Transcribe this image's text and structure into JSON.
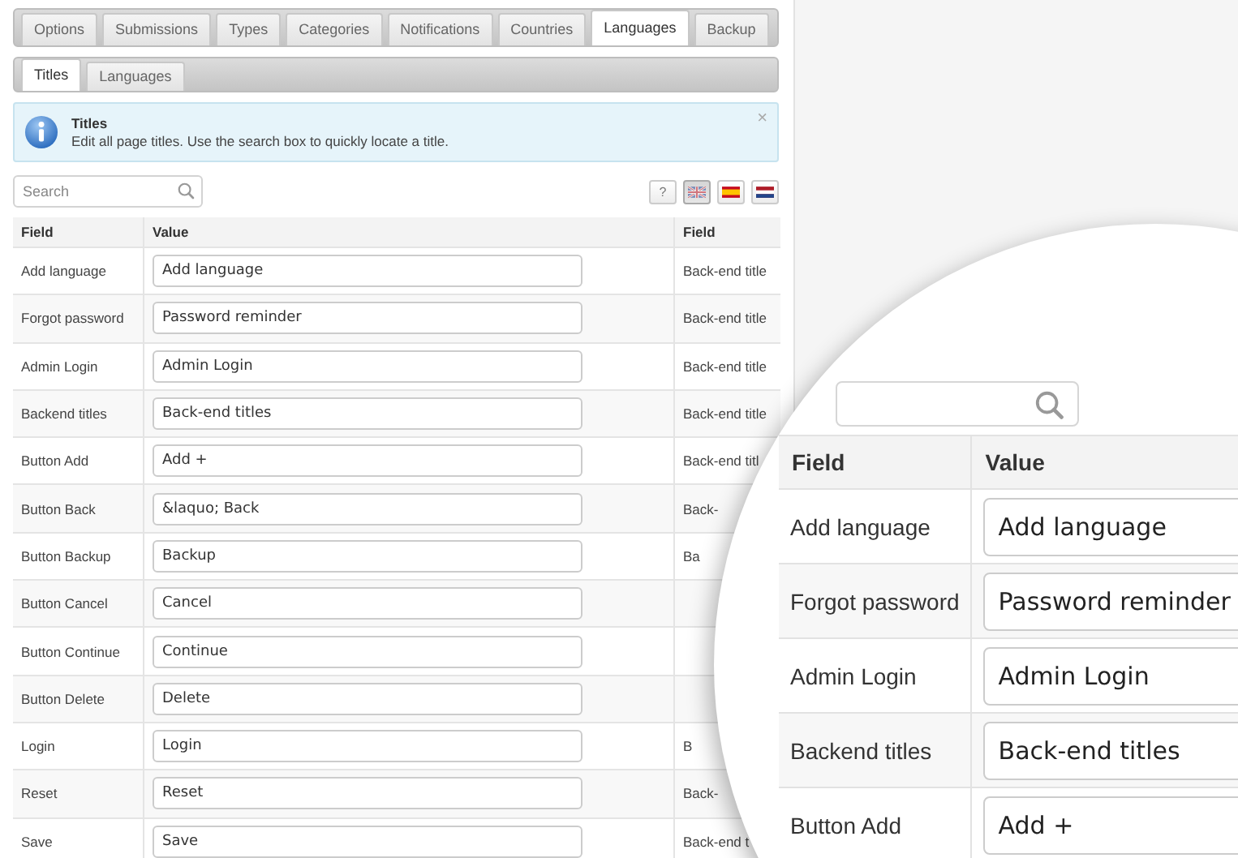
{
  "main_tabs": [
    {
      "label": "Options",
      "selected": false
    },
    {
      "label": "Submissions",
      "selected": false
    },
    {
      "label": "Types",
      "selected": false
    },
    {
      "label": "Categories",
      "selected": false
    },
    {
      "label": "Notifications",
      "selected": false
    },
    {
      "label": "Countries",
      "selected": false
    },
    {
      "label": "Languages",
      "selected": true
    },
    {
      "label": "Backup",
      "selected": false
    }
  ],
  "sub_tabs": [
    {
      "label": "Titles",
      "selected": true
    },
    {
      "label": "Languages",
      "selected": false
    }
  ],
  "info": {
    "title": "Titles",
    "text": "Edit all page titles. Use the search box to quickly locate a title.",
    "close": "×"
  },
  "search": {
    "placeholder": "Search"
  },
  "help_button": "?",
  "language_flags": [
    {
      "kind": "uk",
      "selected": true
    },
    {
      "kind": "es",
      "selected": false
    },
    {
      "kind": "nl",
      "selected": false
    }
  ],
  "table": {
    "columns": [
      "Field",
      "Value",
      "Field"
    ],
    "rows": [
      {
        "field": "Add language",
        "value": "Add language",
        "column_3": "Back-end title"
      },
      {
        "field": "Forgot password",
        "value": "Password reminder",
        "column_3": "Back-end title"
      },
      {
        "field": "Admin Login",
        "value": "Admin Login",
        "column_3": "Back-end title"
      },
      {
        "field": "Backend titles",
        "value": "Back-end titles",
        "column_3": "Back-end title"
      },
      {
        "field": "Button Add",
        "value": "Add +",
        "column_3": "Back-end titl"
      },
      {
        "field": "Button Back",
        "value": "&laquo; Back",
        "column_3": "Back-"
      },
      {
        "field": "Button Backup",
        "value": "Backup",
        "column_3": "Ba"
      },
      {
        "field": "Button Cancel",
        "value": "Cancel"
      },
      {
        "field": "Button Continue",
        "value": "Continue"
      },
      {
        "field": "Button Delete",
        "value": "Delete"
      },
      {
        "field": "Login",
        "value": "Login",
        "column_3": "B"
      },
      {
        "field": "Reset",
        "value": "Reset",
        "column_3": "Back-"
      },
      {
        "field": "Save",
        "value": "Save",
        "column_3": "Back-end t"
      }
    ]
  },
  "magnifier": {
    "columns": [
      "Field",
      "Value"
    ],
    "rows": [
      {
        "field": "Add language",
        "value": "Add language"
      },
      {
        "field": "Forgot password",
        "value": "Password reminder"
      },
      {
        "field": "Admin Login",
        "value": "Admin Login"
      },
      {
        "field": "Backend titles",
        "value": "Back-end titles"
      },
      {
        "field": "Button Add",
        "value": "Add +"
      }
    ]
  }
}
